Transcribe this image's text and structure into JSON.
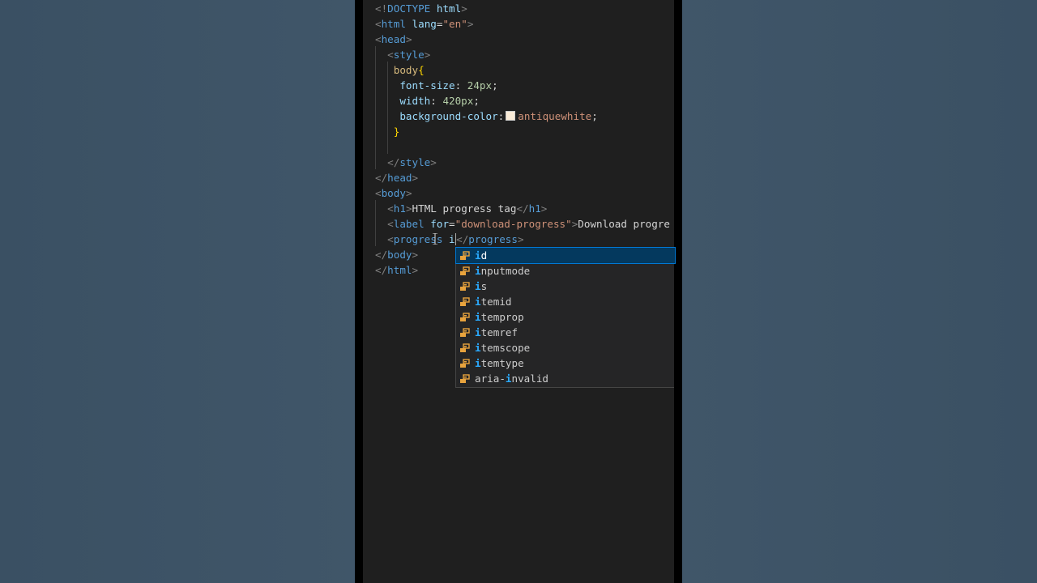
{
  "code_lines": [
    {
      "parts": [
        [
          "punc",
          "<!"
        ],
        [
          "tag",
          "DOCTYPE"
        ],
        [
          "text",
          " "
        ],
        [
          "attr",
          "html"
        ],
        [
          "punc",
          ">"
        ]
      ]
    },
    {
      "parts": [
        [
          "punc",
          "<"
        ],
        [
          "tag",
          "html"
        ],
        [
          "text",
          " "
        ],
        [
          "attr",
          "lang"
        ],
        [
          "text",
          "="
        ],
        [
          "str",
          "\"en\""
        ],
        [
          "punc",
          ">"
        ]
      ]
    },
    {
      "parts": [
        [
          "punc",
          "<"
        ],
        [
          "tag",
          "head"
        ],
        [
          "punc",
          ">"
        ]
      ]
    },
    {
      "parts": [
        [
          "text",
          "  "
        ],
        [
          "punc",
          "<"
        ],
        [
          "tag",
          "style"
        ],
        [
          "punc",
          ">"
        ]
      ]
    },
    {
      "parts": [
        [
          "text",
          "   "
        ],
        [
          "sel",
          "body"
        ],
        [
          "brace",
          "{"
        ]
      ]
    },
    {
      "parts": [
        [
          "text",
          "    "
        ],
        [
          "prop",
          "font-size"
        ],
        [
          "text",
          ": "
        ],
        [
          "val",
          "24px"
        ],
        [
          "text",
          ";"
        ]
      ]
    },
    {
      "parts": [
        [
          "text",
          "    "
        ],
        [
          "prop",
          "width"
        ],
        [
          "text",
          ": "
        ],
        [
          "val",
          "420px"
        ],
        [
          "text",
          ";"
        ]
      ]
    },
    {
      "parts": [
        [
          "text",
          "    "
        ],
        [
          "prop",
          "background-color"
        ],
        [
          "text",
          ":"
        ],
        [
          "swatch",
          ""
        ],
        [
          "valw",
          "antiquewhite"
        ],
        [
          "text",
          ";"
        ]
      ]
    },
    {
      "parts": [
        [
          "text",
          "   "
        ],
        [
          "brace",
          "}"
        ]
      ]
    },
    {
      "parts": [
        [
          "text",
          ""
        ]
      ]
    },
    {
      "parts": [
        [
          "text",
          "  "
        ],
        [
          "punc",
          "</"
        ],
        [
          "tag",
          "style"
        ],
        [
          "punc",
          ">"
        ]
      ]
    },
    {
      "parts": [
        [
          "punc",
          "</"
        ],
        [
          "tag",
          "head"
        ],
        [
          "punc",
          ">"
        ]
      ]
    },
    {
      "parts": [
        [
          "punc",
          "<"
        ],
        [
          "tag",
          "body"
        ],
        [
          "punc",
          ">"
        ]
      ]
    },
    {
      "parts": [
        [
          "text",
          "  "
        ],
        [
          "punc",
          "<"
        ],
        [
          "tag",
          "h1"
        ],
        [
          "punc",
          ">"
        ],
        [
          "text",
          "HTML progress tag"
        ],
        [
          "punc",
          "</"
        ],
        [
          "tag",
          "h1"
        ],
        [
          "punc",
          ">"
        ]
      ]
    },
    {
      "parts": [
        [
          "text",
          "  "
        ],
        [
          "punc",
          "<"
        ],
        [
          "tag",
          "label"
        ],
        [
          "text",
          " "
        ],
        [
          "attr",
          "for"
        ],
        [
          "text",
          "="
        ],
        [
          "str",
          "\"download-progress\""
        ],
        [
          "punc",
          ">"
        ],
        [
          "text",
          "Download progre"
        ]
      ]
    },
    {
      "parts": [
        [
          "text",
          "  "
        ],
        [
          "punc",
          "<"
        ],
        [
          "tag",
          "progress"
        ],
        [
          "text",
          " "
        ],
        [
          "attr",
          "i"
        ],
        [
          "cursor",
          ""
        ],
        [
          "punc",
          "</"
        ],
        [
          "tag",
          "progress"
        ],
        [
          "punc",
          ">"
        ]
      ]
    },
    {
      "parts": [
        [
          "punc",
          "</"
        ],
        [
          "tag",
          "body"
        ],
        [
          "punc",
          ">"
        ]
      ]
    },
    {
      "parts": [
        [
          "punc",
          "</"
        ],
        [
          "tag",
          "html"
        ],
        [
          "punc",
          ">"
        ]
      ]
    }
  ],
  "suggestions": [
    {
      "pre": "",
      "hl": "i",
      "post": "d"
    },
    {
      "pre": "",
      "hl": "i",
      "post": "nputmode"
    },
    {
      "pre": "",
      "hl": "i",
      "post": "s"
    },
    {
      "pre": "",
      "hl": "i",
      "post": "temid"
    },
    {
      "pre": "",
      "hl": "i",
      "post": "temprop"
    },
    {
      "pre": "",
      "hl": "i",
      "post": "temref"
    },
    {
      "pre": "",
      "hl": "i",
      "post": "temscope"
    },
    {
      "pre": "",
      "hl": "i",
      "post": "temtype"
    },
    {
      "pre": "aria-",
      "hl": "i",
      "post": "nvalid"
    }
  ],
  "suggestion_icon": "property-icon",
  "selected_suggestion": 0,
  "colors": {
    "editor_bg": "#1f1f1f",
    "tag": "#569cd6",
    "attribute": "#9cdcfe",
    "string": "#ce9178",
    "selected_suggestion_bg": "#04395e",
    "suggestion_highlight": "#2aaaff",
    "property_icon": "#e8a33d"
  }
}
